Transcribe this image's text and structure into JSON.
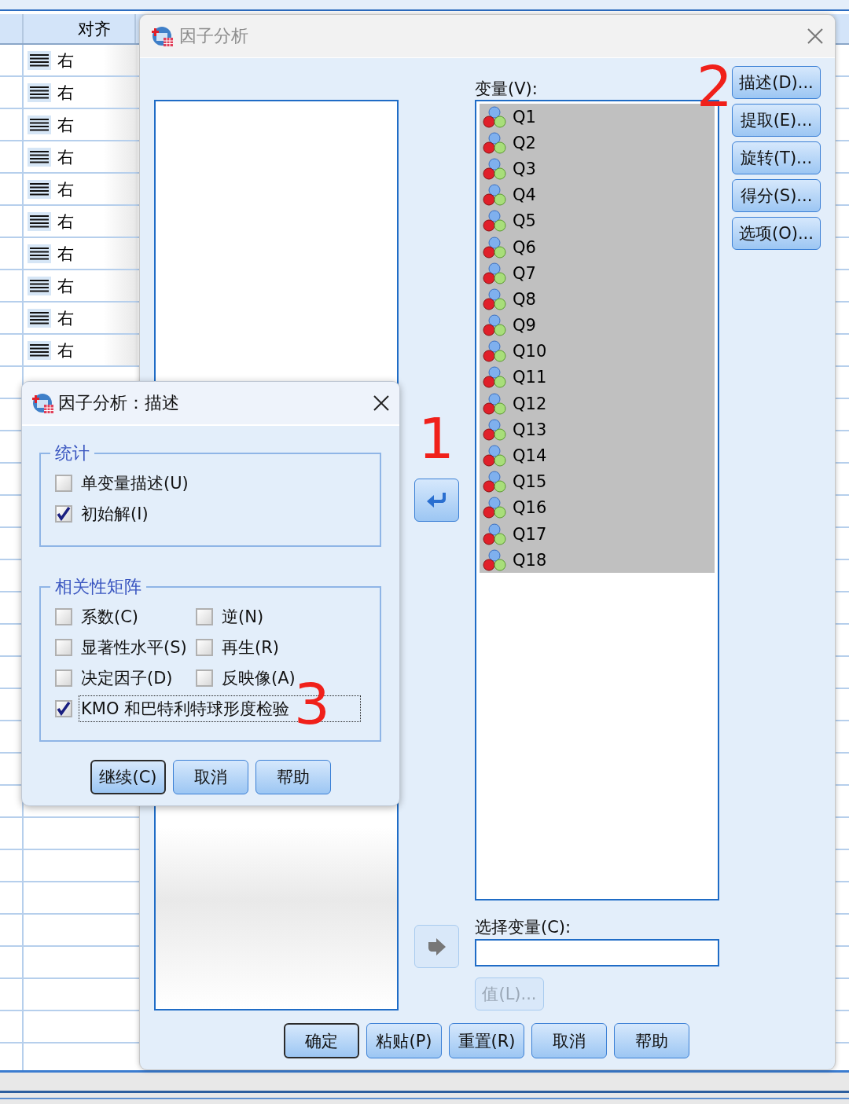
{
  "sheet": {
    "column_header": "对齐",
    "rows": [
      {
        "alignment": "右"
      },
      {
        "alignment": "右"
      },
      {
        "alignment": "右"
      },
      {
        "alignment": "右"
      },
      {
        "alignment": "右"
      },
      {
        "alignment": "右"
      },
      {
        "alignment": "右"
      },
      {
        "alignment": "右"
      },
      {
        "alignment": "右"
      },
      {
        "alignment": "右"
      }
    ]
  },
  "main_dialog": {
    "title": "因子分析",
    "active": false,
    "move_buttons": [
      {
        "kind": "back",
        "disabled": false
      },
      {
        "kind": "forward",
        "disabled": true
      }
    ],
    "variables_label": "变量(V):",
    "variables": [
      {
        "name": "Q1",
        "selected": true
      },
      {
        "name": "Q2",
        "selected": true
      },
      {
        "name": "Q3",
        "selected": true
      },
      {
        "name": "Q4",
        "selected": true
      },
      {
        "name": "Q5",
        "selected": true
      },
      {
        "name": "Q6",
        "selected": true
      },
      {
        "name": "Q7",
        "selected": true
      },
      {
        "name": "Q8",
        "selected": true
      },
      {
        "name": "Q9",
        "selected": true
      },
      {
        "name": "Q10",
        "selected": true
      },
      {
        "name": "Q11",
        "selected": true
      },
      {
        "name": "Q12",
        "selected": true
      },
      {
        "name": "Q13",
        "selected": true
      },
      {
        "name": "Q14",
        "selected": true
      },
      {
        "name": "Q15",
        "selected": true
      },
      {
        "name": "Q16",
        "selected": true
      },
      {
        "name": "Q17",
        "selected": true
      },
      {
        "name": "Q18",
        "selected": true
      }
    ],
    "side_buttons": [
      "描述(D)...",
      "提取(E)...",
      "旋转(T)...",
      "得分(S)...",
      "选项(O)..."
    ],
    "selection_label": "选择变量(C):",
    "value_button": {
      "label": "值(L)...",
      "disabled": true
    },
    "footer_buttons": [
      {
        "label": "确定",
        "default": true
      },
      {
        "label": "粘贴(P)",
        "default": false
      },
      {
        "label": "重置(R)",
        "default": false
      },
      {
        "label": "取消",
        "default": false
      },
      {
        "label": "帮助",
        "default": false
      }
    ]
  },
  "sub_dialog": {
    "title": "因子分析：描述",
    "active": true,
    "groups": [
      {
        "title": "统计",
        "options": [
          {
            "label": "单变量描述(U)",
            "checked": false,
            "wide": false,
            "focused": false
          },
          {
            "label": "初始解(I)",
            "checked": true,
            "wide": true,
            "focused": false
          }
        ]
      },
      {
        "title": "相关性矩阵",
        "options": [
          {
            "label": "系数(C)",
            "checked": false,
            "wide": false,
            "focused": false
          },
          {
            "label": "逆(N)",
            "checked": false,
            "wide": false,
            "focused": false
          },
          {
            "label": "显著性水平(S)",
            "checked": false,
            "wide": false,
            "focused": false
          },
          {
            "label": "再生(R)",
            "checked": false,
            "wide": false,
            "focused": false
          },
          {
            "label": "决定因子(D)",
            "checked": false,
            "wide": false,
            "focused": false
          },
          {
            "label": "反映像(A)",
            "checked": false,
            "wide": false,
            "focused": false
          },
          {
            "label": "KMO 和巴特利特球形度检验",
            "checked": true,
            "wide": true,
            "focused": true
          }
        ]
      }
    ],
    "buttons": [
      {
        "label": "继续(C)",
        "default": true
      },
      {
        "label": "取消",
        "default": false
      },
      {
        "label": "帮助",
        "default": false
      }
    ]
  },
  "annotations": [
    {
      "text": "1"
    },
    {
      "text": "2"
    },
    {
      "text": "3"
    }
  ]
}
